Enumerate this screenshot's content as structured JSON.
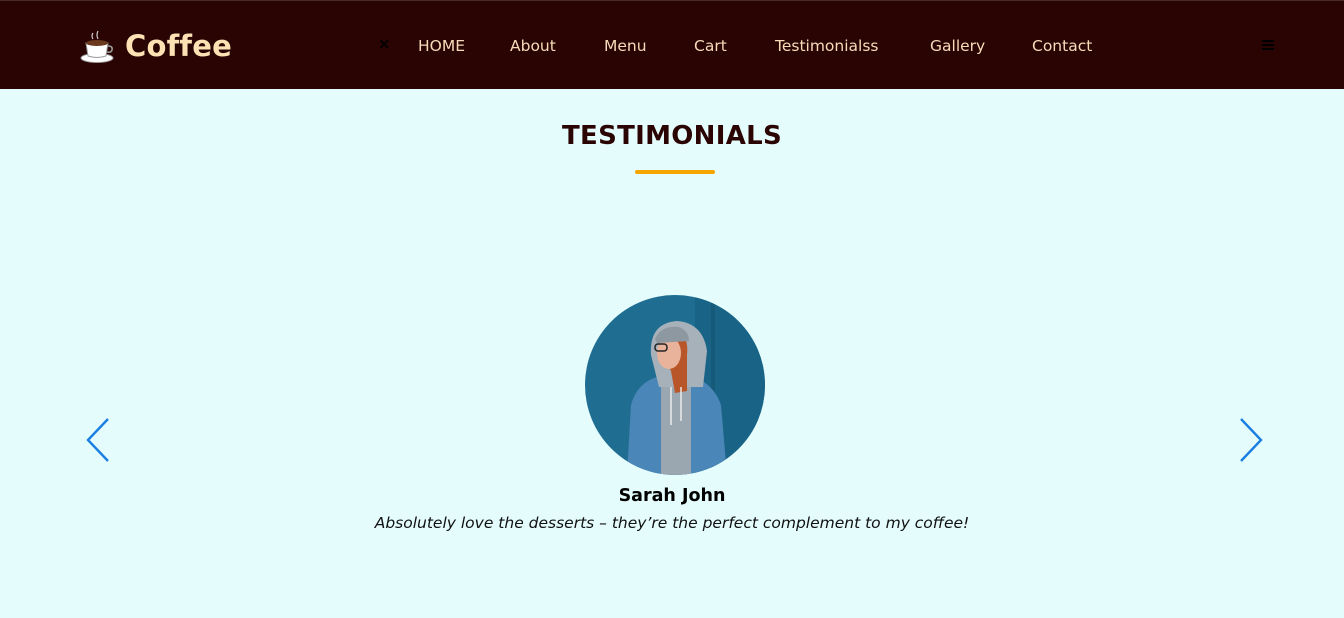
{
  "brand": {
    "name": "Coffee",
    "icon": "coffee-cup-icon"
  },
  "nav": {
    "close_icon": "close-icon",
    "close_glyph": "×",
    "menu_icon": "menu-icon",
    "links": [
      "HOME",
      "About",
      "Menu",
      "Cart",
      "Testimonialss",
      "Gallery",
      "Contact"
    ]
  },
  "testimonials": {
    "title": "TESTIMONIALS",
    "current": {
      "name": "Sarah John",
      "quote": "Absolutely love the desserts – they’re the perfect complement to my coffee!",
      "avatar": "person-photo"
    },
    "prev_icon": "chevron-left-icon",
    "next_icon": "chevron-right-icon"
  },
  "colors": {
    "navbar_bg": "#2a0303",
    "nav_text": "#f6dcb8",
    "brand_text": "#ffe2b4",
    "page_bg": "#e4fcfc",
    "accent": "#f5a400",
    "arrow": "#1a7fe0"
  }
}
